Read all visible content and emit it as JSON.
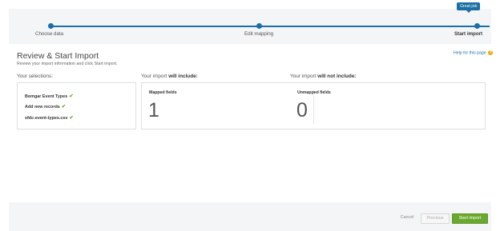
{
  "stepper": {
    "badge": "Great job",
    "steps": [
      {
        "label": "Choose data"
      },
      {
        "label": "Edit mapping"
      },
      {
        "label": "Start import"
      }
    ]
  },
  "header": {
    "title": "Review & Start Import",
    "subtitle": "Review your import information and click Start import.",
    "help_link": "Help for this page",
    "help_icon": "?"
  },
  "sections": {
    "selections_label": "Your selections:",
    "include_prefix": "Your import ",
    "include_bold": "will include:",
    "exclude_prefix": "Your import ",
    "exclude_bold": "will not include:"
  },
  "selections": {
    "items": [
      {
        "label": "Bomgar Event Types"
      },
      {
        "label": "Add new records"
      },
      {
        "label": "sfdc-event-types.csv"
      }
    ],
    "check_glyph": "✔"
  },
  "summary": {
    "mapped_label": "Mapped fields",
    "mapped_count": "1",
    "unmapped_label": "Unmapped fields",
    "unmapped_count": "0"
  },
  "footer": {
    "cancel": "Cancel",
    "previous": "Previous",
    "start": "Start import"
  },
  "colors": {
    "accent": "#1a6fa3",
    "success": "#6aa82f",
    "check": "#6fae2b",
    "help_icon": "#f0a500"
  }
}
